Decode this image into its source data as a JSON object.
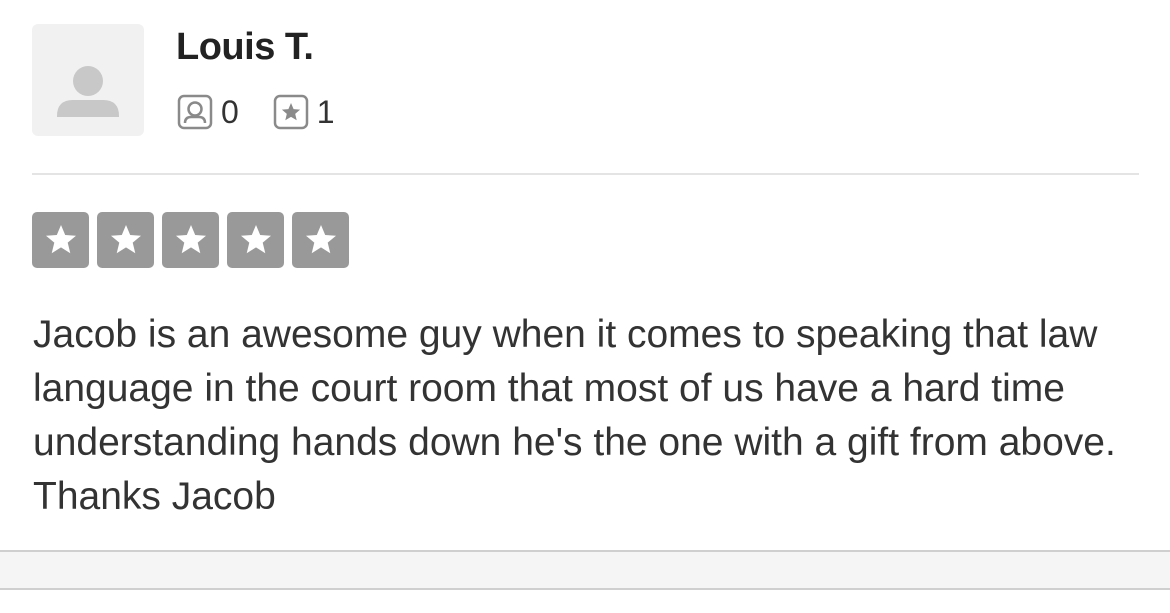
{
  "reviewer": {
    "name": "Louis T.",
    "avatar_icon": "default-user-avatar-icon",
    "friends_icon": "friends-icon",
    "friends_count": "0",
    "reviews_icon": "review-star-icon",
    "reviews_count": "1"
  },
  "review": {
    "rating": 5,
    "rating_max": 5,
    "star_color": "#999999",
    "text": "Jacob is an awesome guy when it comes to speaking that law language in the court room that most of us have a hard time understanding hands down he's the one with a gift from above. Thanks Jacob"
  }
}
